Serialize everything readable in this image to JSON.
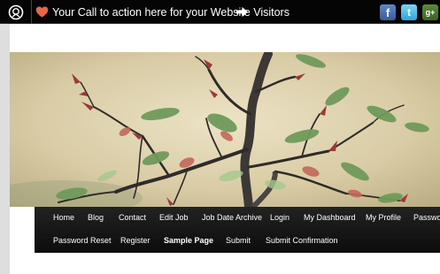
{
  "topbar": {
    "cta_text": "Your Call to action here for your Website Visitors",
    "toggle_icon": "circle-arrow-icon",
    "heart_icon": "heart-icon",
    "arrow_icon": "right-arrow-icon",
    "social": [
      {
        "name": "facebook",
        "glyph": "f",
        "color": "#3b5b9c"
      },
      {
        "name": "twitter",
        "glyph": "t",
        "color": "#2ea6dd"
      },
      {
        "name": "google-plus",
        "glyph": "g+",
        "color": "#3b6422"
      }
    ]
  },
  "header_image": {
    "subject": "bonsai tree branches with red and green leaves"
  },
  "nav": {
    "row1": [
      "Home",
      "Blog",
      "Contact",
      "Edit Job",
      "Job Date Archive",
      "Login",
      "My Dashboard",
      "My Profile",
      "Passwo"
    ],
    "row2": [
      "Password Reset",
      "Register",
      "Sample Page",
      "Submit",
      "Submit Confirmation"
    ],
    "active": "Sample Page"
  },
  "colors": {
    "topbar_bg": "#050505",
    "nav_bg": "#111111",
    "gutter": "#dedede",
    "heart": "#e8664a"
  }
}
